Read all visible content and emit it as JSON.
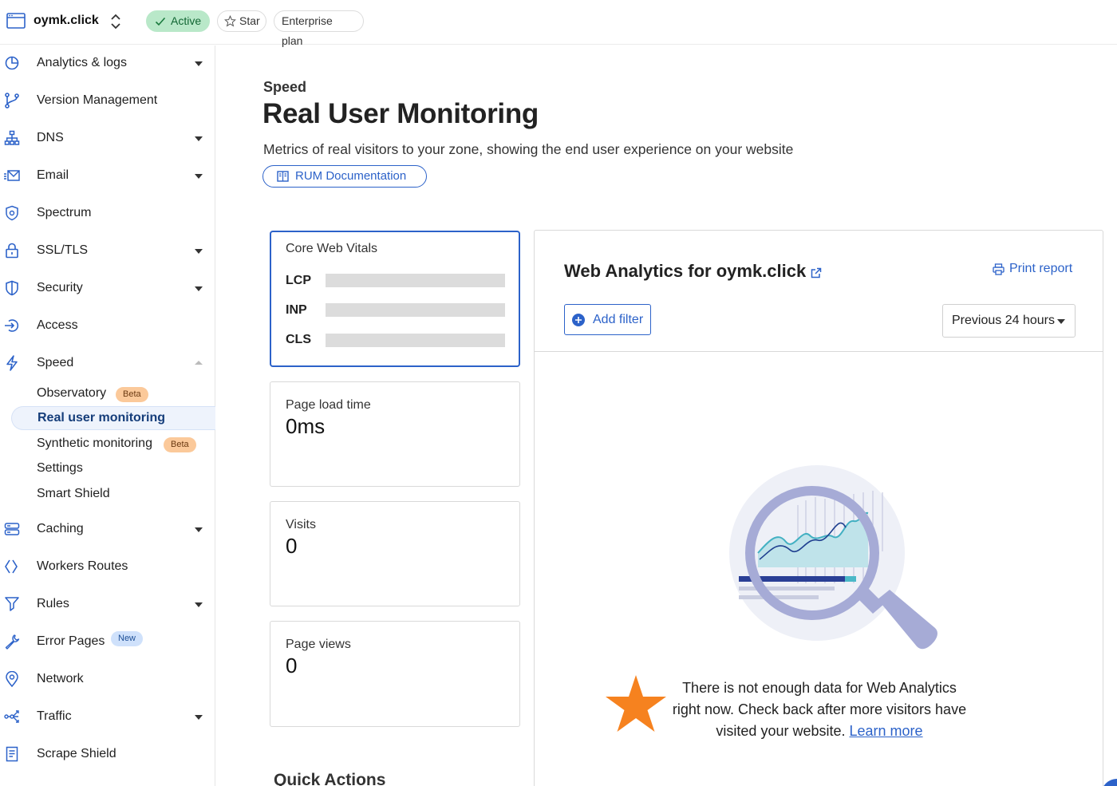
{
  "topbar": {
    "site_name": "oymk.click",
    "status_label": "Active",
    "star_label": "Star",
    "plan_label": "Enterprise plan"
  },
  "sidebar": {
    "items": [
      {
        "label": "Analytics & logs",
        "icon": "analytics-icon",
        "expandable": true
      },
      {
        "label": "Version Management",
        "icon": "branch-icon",
        "expandable": false
      },
      {
        "label": "DNS",
        "icon": "dns-icon",
        "expandable": true
      },
      {
        "label": "Email",
        "icon": "email-icon",
        "expandable": true
      },
      {
        "label": "Spectrum",
        "icon": "spectrum-icon",
        "expandable": false
      },
      {
        "label": "SSL/TLS",
        "icon": "lock-icon",
        "expandable": true
      },
      {
        "label": "Security",
        "icon": "shield-icon",
        "expandable": true
      },
      {
        "label": "Access",
        "icon": "access-icon",
        "expandable": false
      },
      {
        "label": "Speed",
        "icon": "lightning-icon",
        "expanded": true
      },
      {
        "label": "Caching",
        "icon": "caching-icon",
        "expandable": true
      },
      {
        "label": "Workers Routes",
        "icon": "workers-icon",
        "expandable": false
      },
      {
        "label": "Rules",
        "icon": "rules-icon",
        "expandable": true
      },
      {
        "label": "Error Pages",
        "icon": "wrench-icon",
        "expandable": false
      },
      {
        "label": "Network",
        "icon": "location-pin-icon",
        "expandable": false
      },
      {
        "label": "Traffic",
        "icon": "traffic-icon",
        "expandable": true
      },
      {
        "label": "Scrape Shield",
        "icon": "document-icon",
        "expandable": false
      }
    ],
    "speed_subitems": [
      {
        "label": "Observatory"
      },
      {
        "label": "Real user monitoring",
        "selected": true
      },
      {
        "label": "Synthetic monitoring"
      },
      {
        "label": "Settings"
      },
      {
        "label": "Smart Shield"
      }
    ],
    "badge_beta": "Beta",
    "badge_new": "New"
  },
  "main": {
    "eyebrow": "Speed",
    "title": "Real User Monitoring",
    "subtitle": "Metrics of real visitors to your zone, showing the end user experience on your website",
    "doc_button": "RUM Documentation",
    "core_web_vitals": {
      "title": "Core Web Vitals",
      "metrics": [
        "LCP",
        "INP",
        "CLS"
      ]
    },
    "page_load": {
      "title": "Page load time",
      "value": "0ms"
    },
    "visits": {
      "title": "Visits",
      "value": "0"
    },
    "page_views": {
      "title": "Page views",
      "value": "0"
    },
    "quick_actions": "Quick Actions"
  },
  "analytics": {
    "title": "Web Analytics for oymk.click",
    "print_label": "Print report",
    "add_filter_label": "Add filter",
    "time_range": "Previous 24 hours",
    "empty_message": "There is not enough data for Web Analytics right now. Check back after more visitors have visited your website.",
    "learn_more": "Learn more"
  },
  "colors": {
    "accent": "#2c62c9",
    "active_badge_bg": "#b9e8c9",
    "beta_badge_bg": "#fbc99a",
    "new_badge_bg": "#cfe1fb",
    "star": "#f6821f"
  }
}
